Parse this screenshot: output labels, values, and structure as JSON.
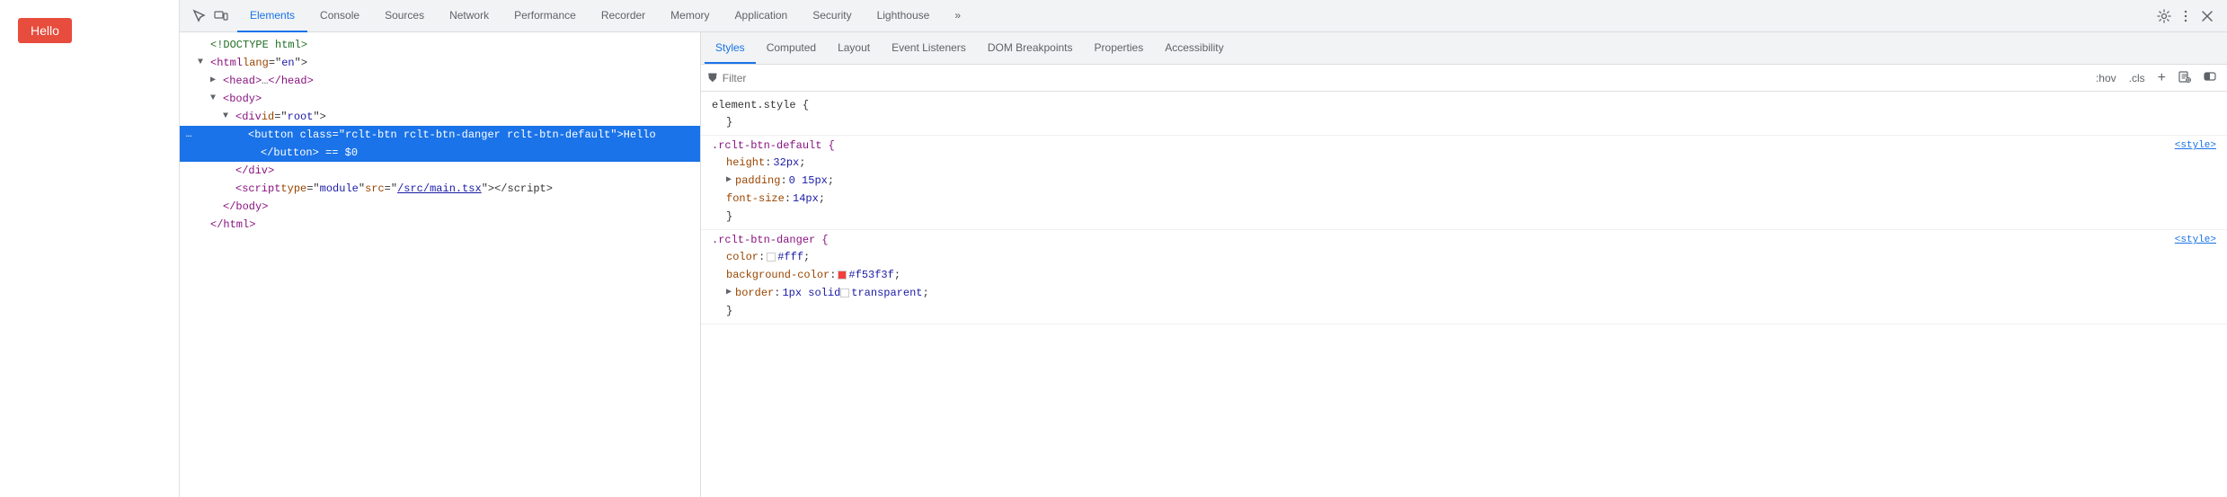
{
  "page": {
    "hello_button": "Hello"
  },
  "devtools": {
    "toolbar_tabs": [
      {
        "id": "elements",
        "label": "Elements",
        "active": true
      },
      {
        "id": "console",
        "label": "Console",
        "active": false
      },
      {
        "id": "sources",
        "label": "Sources",
        "active": false
      },
      {
        "id": "network",
        "label": "Network",
        "active": false
      },
      {
        "id": "performance",
        "label": "Performance",
        "active": false
      },
      {
        "id": "recorder",
        "label": "Recorder",
        "active": false
      },
      {
        "id": "memory",
        "label": "Memory",
        "active": false
      },
      {
        "id": "application",
        "label": "Application",
        "active": false
      },
      {
        "id": "security",
        "label": "Security",
        "active": false
      },
      {
        "id": "lighthouse",
        "label": "Lighthouse",
        "active": false
      }
    ],
    "styles_tabs": [
      {
        "id": "styles",
        "label": "Styles",
        "active": true
      },
      {
        "id": "computed",
        "label": "Computed",
        "active": false
      },
      {
        "id": "layout",
        "label": "Layout",
        "active": false
      },
      {
        "id": "event-listeners",
        "label": "Event Listeners",
        "active": false
      },
      {
        "id": "dom-breakpoints",
        "label": "DOM Breakpoints",
        "active": false
      },
      {
        "id": "properties",
        "label": "Properties",
        "active": false
      },
      {
        "id": "accessibility",
        "label": "Accessibility",
        "active": false
      }
    ],
    "filter_placeholder": "Filter",
    "filter_hov": ":hov",
    "filter_cls": ".cls",
    "styles": {
      "element_style_selector": "element.style {",
      "element_style_close": "}",
      "rules": [
        {
          "selector": ".rclt-btn-default {",
          "close": "}",
          "source": "<style>",
          "properties": [
            {
              "name": "height",
              "value": "32px",
              "colon": ":",
              "semi": ";"
            },
            {
              "name": "padding",
              "value": "0 15px",
              "colon": ":",
              "semi": ";",
              "has_arrow": true
            },
            {
              "name": "font-size",
              "value": "14px",
              "colon": ":",
              "semi": ";"
            }
          ]
        },
        {
          "selector": ".rclt-btn-danger {",
          "close": "}",
          "source": "<style>",
          "properties": [
            {
              "name": "color",
              "value": "#fff",
              "colon": ":",
              "semi": ";",
              "swatch": "#ffffff",
              "swatch_border": "#ccc"
            },
            {
              "name": "background-color",
              "value": "#f53f3f",
              "colon": ":",
              "semi": ";",
              "swatch": "#f53f3f"
            },
            {
              "name": "border",
              "value": "1px solid",
              "extra": "transparent",
              "colon": ":",
              "semi": ";",
              "has_arrow": true,
              "swatch": "transparent",
              "swatch_border": "#ccc"
            }
          ]
        }
      ]
    }
  }
}
